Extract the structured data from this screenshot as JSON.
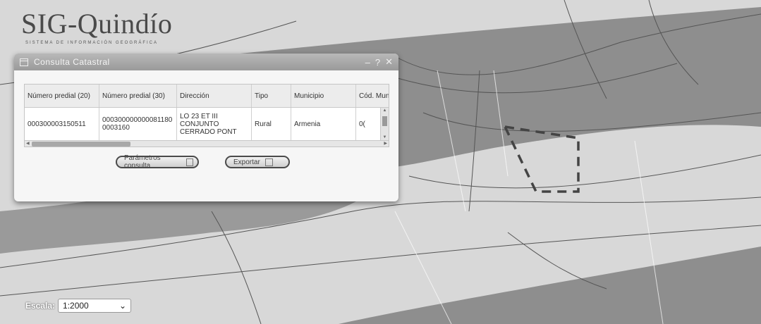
{
  "logo": {
    "title": "SIG-Quindío",
    "subtitle": "SISTEMA DE INFORMACIÓN GEOGRÁFICA"
  },
  "panel": {
    "title": "Consulta Catastral",
    "controls": [
      "–",
      "?",
      "✕"
    ],
    "columns": [
      "Número predial (20)",
      "Número predial (30)",
      "Dirección",
      "Tipo",
      "Municipio",
      "Cód. Muni"
    ],
    "row": {
      "predial20": "000300003150511",
      "predial30": "000300000000081180 0003160",
      "direccion": "LO 23 ET III CONJUNTO CERRADO PONT",
      "tipo": "Rural",
      "municipio": "Armenia",
      "cod": "0("
    },
    "buttons": {
      "params": "Parámetros consulta",
      "export": "Exportar"
    }
  },
  "scale": {
    "label": "Escala:",
    "value": "1:2000"
  },
  "colors": {
    "map_light": "#d8d8d8",
    "map_dark": "#8e8e8e",
    "parcel_outline": "#444444"
  },
  "icons": [
    "window-icon",
    "minimize-icon",
    "help-icon",
    "close-icon",
    "popup-icon",
    "chevron-down-icon"
  ]
}
